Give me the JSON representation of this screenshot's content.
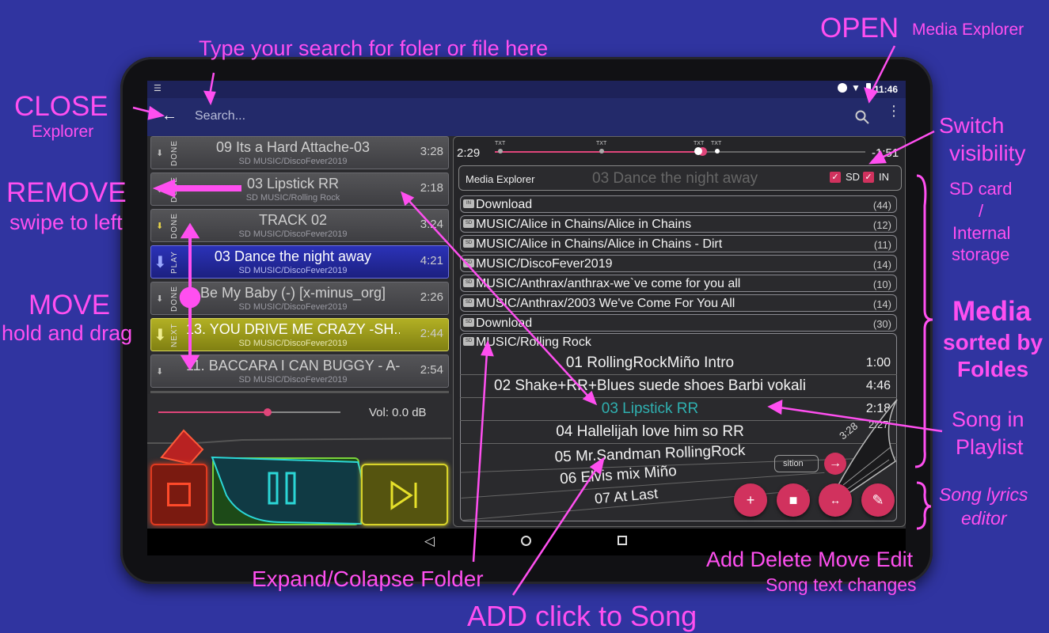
{
  "statusbar": {
    "time": "11:46"
  },
  "toolbar": {
    "search_placeholder": "Search..."
  },
  "playlist": [
    {
      "status": "DONE",
      "title": "09 Its a Hard Attache-03",
      "path": "SD MUSIC/DiscoFever2019",
      "duration": "3:28"
    },
    {
      "status": "DONE",
      "title": "03 Lipstick RR",
      "path": "SD MUSIC/Rolling Rock",
      "duration": "2:18"
    },
    {
      "status": "DONE",
      "title": "TRACK 02",
      "path": "SD MUSIC/DiscoFever2019",
      "duration": "3:24"
    },
    {
      "status": "PLAY",
      "title": "03 Dance the night away",
      "path": "SD MUSIC/DiscoFever2019",
      "duration": "4:21"
    },
    {
      "status": "DONE",
      "title": "Be My Baby (-) [x-minus_org]",
      "path": "SD MUSIC/DiscoFever2019",
      "duration": "2:26"
    },
    {
      "status": "NEXT",
      "title": "13. YOU DRIVE ME CRAZY -SH...",
      "path": "SD MUSIC/DiscoFever2019",
      "duration": "2:44"
    },
    {
      "status": "",
      "title": "11. BACCARA I CAN BUGGY - A-",
      "path": "SD MUSIC/DiscoFever2019",
      "duration": "2:54"
    }
  ],
  "player": {
    "volume_label": "Vol: 0.0 dB",
    "volume_fraction": 0.6,
    "elapsed": "2:29",
    "remaining": "-1:51",
    "progress_fraction": 0.56,
    "lyric_markers": [
      "TXT",
      "TXT",
      "TXT",
      "TXT"
    ]
  },
  "explorer": {
    "label": "Media Explorer",
    "now_playing": "03 Dance the night away",
    "sd_label": "SD",
    "in_label": "IN",
    "sd_checked": true,
    "in_checked": true,
    "folders": [
      {
        "icon": "IN",
        "name": "Download",
        "count": "(44)"
      },
      {
        "icon": "SD",
        "name": "MUSIC/Alice in Chains/Alice in Chains",
        "count": "(12)"
      },
      {
        "icon": "SD",
        "name": "MUSIC/Alice in Chains/Alice in Chains - Dirt",
        "count": "(11)"
      },
      {
        "icon": "SD",
        "name": "MUSIC/DiscoFever2019",
        "count": "(14)"
      },
      {
        "icon": "SD",
        "name": "MUSIC/Anthrax/anthrax-we`ve come for you all",
        "count": "(10)"
      },
      {
        "icon": "SD",
        "name": "MUSIC/Anthrax/2003 We've Come For You All",
        "count": "(14)"
      },
      {
        "icon": "SD",
        "name": "Download",
        "count": "(30)"
      },
      {
        "icon": "SD",
        "name": "MUSIC/Rolling Rock",
        "count": ""
      }
    ],
    "songs": [
      {
        "name": "01 RollingRockMiño Intro",
        "duration": "1:00",
        "in_playlist": false
      },
      {
        "name": "02 Shake+RR+Blues suede shoes Barbi vokali",
        "duration": "4:46",
        "in_playlist": false
      },
      {
        "name": "03 Lipstick RR",
        "duration": "2:18",
        "in_playlist": true
      },
      {
        "name": "04 Hallelijah love him so RR",
        "duration": "",
        "in_playlist": false
      },
      {
        "name": "05 Mr.Sandman RollingRock",
        "duration": "",
        "in_playlist": false
      },
      {
        "name": "06 Elvis mix Miño",
        "duration": "",
        "in_playlist": false
      },
      {
        "name": "07 At Last",
        "duration": "",
        "in_playlist": false
      }
    ],
    "curl_duration": "3:28",
    "curl_duration2": "2:27",
    "partial_label": "sition"
  },
  "annotations": {
    "search_hint": "Type your search for foler or file here",
    "open_title": "OPEN",
    "open_sub": "Media Explorer",
    "close_title": "CLOSE",
    "close_sub": "Explorer",
    "switch_line1": "Switch",
    "switch_line2": "visibility",
    "remove_title": "REMOVE",
    "remove_sub": "swipe to left",
    "sd_line1": "SD card",
    "sd_line2": "/",
    "sd_line3": "Internal",
    "sd_line4": "storage",
    "move_title": "MOVE",
    "move_sub": "hold and drag",
    "media_line1": "Media",
    "media_line2": "sorted by",
    "media_line3": "Foldes",
    "song_line1": "Song in",
    "song_line2": "Playlist",
    "lyrics_line1": "Song lyrics",
    "lyrics_line2": "editor",
    "actions_title": "Add Delete Move Edit",
    "actions_sub": "Song text changes",
    "expand": "Expand/Colapse Folder",
    "add": "ADD click to Song"
  },
  "colors": {
    "annotation": "#ff4ff0",
    "background": "#3034a0",
    "fab": "#d1325e",
    "accent_teal": "#2fb0b0"
  }
}
